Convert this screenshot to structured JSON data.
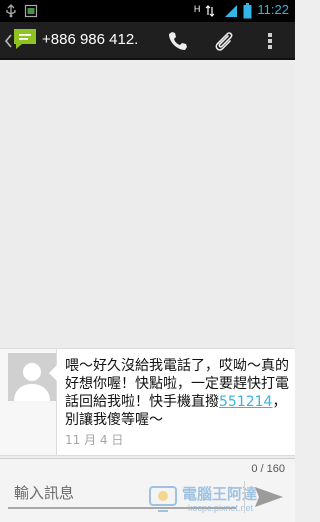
{
  "status_bar": {
    "time": "11:22",
    "network": "H",
    "icons": [
      "usb-icon",
      "screenshot-icon",
      "data-arrows-icon",
      "signal-icon",
      "battery-icon"
    ]
  },
  "action_bar": {
    "title": "+886 986 412.",
    "back_icon": "chevron-left-icon",
    "app_icon": "messaging-icon",
    "actions": [
      "phone-icon",
      "attach-icon",
      "overflow-menu-icon"
    ]
  },
  "conversation": {
    "messages": [
      {
        "text_before": "喂～好久沒給我電話了，哎呦～真的好想你喔！快點啦，一定要趕快打電話回給我啦！快手機直撥",
        "link": "551214",
        "text_after": "，別讓我傻等喔～",
        "date": "11 月 4 日"
      }
    ]
  },
  "compose": {
    "counter": "0 / 160",
    "placeholder": "輸入訊息",
    "value": ""
  },
  "watermark": {
    "text": "電腦王阿達",
    "url": "kocpc.pixnet.net"
  },
  "colors": {
    "accent": "#33b5e5",
    "status_bar_bg": "#000000",
    "action_bar_bg": "#1f1f1f",
    "app_icon_green": "#8fc31f"
  }
}
